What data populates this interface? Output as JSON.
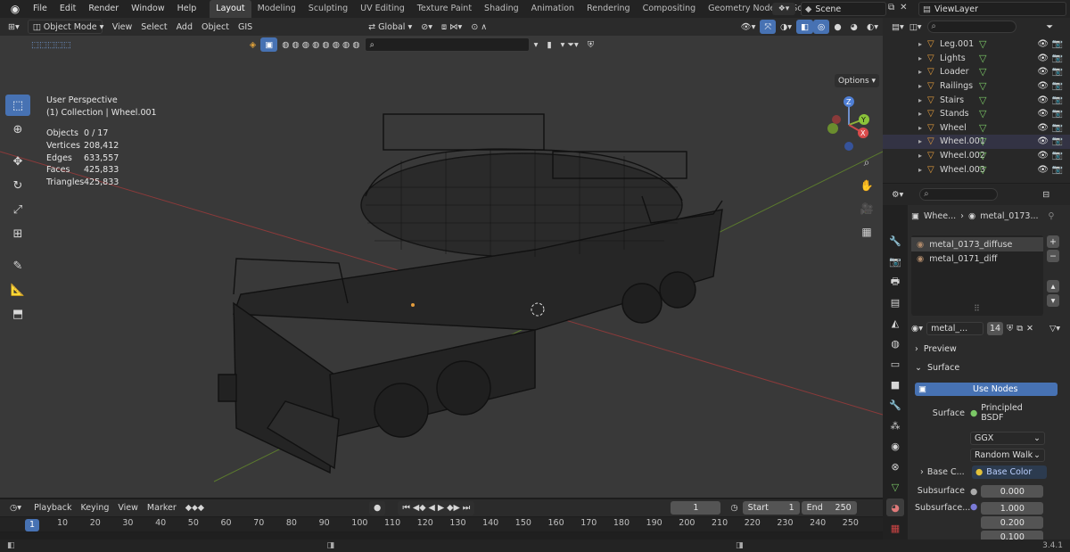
{
  "topbar": {
    "menus": [
      "File",
      "Edit",
      "Render",
      "Window",
      "Help"
    ],
    "workspaces": [
      "Layout",
      "Modeling",
      "Sculpting",
      "UV Editing",
      "Texture Paint",
      "Shading",
      "Animation",
      "Rendering",
      "Compositing",
      "Geometry Nodes",
      "Scripting"
    ],
    "active_workspace": "Layout",
    "scene": "Scene",
    "view_layer": "ViewLayer"
  },
  "viewport_header": {
    "mode": "Object Mode",
    "menus": [
      "View",
      "Select",
      "Add",
      "Object",
      "GIS"
    ],
    "transform_orientation": "Global",
    "options_label": "Options"
  },
  "viewport": {
    "perspective": "User Perspective",
    "collection": "(1) Collection | Wheel.001",
    "stats": [
      {
        "label": "Objects",
        "value": "0 / 17"
      },
      {
        "label": "Vertices",
        "value": "208,412"
      },
      {
        "label": "Edges",
        "value": "633,557"
      },
      {
        "label": "Faces",
        "value": "425,833"
      },
      {
        "label": "Triangles",
        "value": "425,833"
      }
    ],
    "gizmo": {
      "z": "Z",
      "y": "Y",
      "x": "X"
    }
  },
  "timeline": {
    "menus": [
      "Playback",
      "Keying",
      "View",
      "Marker"
    ],
    "current_frame": "1",
    "start_label": "Start",
    "start": "1",
    "end_label": "End",
    "end": "250",
    "ticks": [
      "1",
      "10",
      "20",
      "30",
      "40",
      "50",
      "60",
      "70",
      "80",
      "90",
      "100",
      "110",
      "120",
      "130",
      "140",
      "150",
      "160",
      "170",
      "180",
      "190",
      "200",
      "210",
      "220",
      "230",
      "240",
      "250"
    ]
  },
  "outliner": {
    "items": [
      {
        "name": "Leg.001",
        "selected": false
      },
      {
        "name": "Lights",
        "selected": false
      },
      {
        "name": "Loader",
        "selected": false
      },
      {
        "name": "Railings",
        "selected": false
      },
      {
        "name": "Stairs",
        "selected": false
      },
      {
        "name": "Stands",
        "selected": false
      },
      {
        "name": "Wheel",
        "selected": false
      },
      {
        "name": "Wheel.001",
        "selected": true
      },
      {
        "name": "Wheel.002",
        "selected": false
      },
      {
        "name": "Wheel.003",
        "selected": false
      }
    ]
  },
  "properties": {
    "breadcrumb_object": "Whee...",
    "breadcrumb_material": "metal_0173...",
    "materials": [
      "metal_0173_diffuse",
      "metal_0171_diff"
    ],
    "material_name": "metal_...",
    "users": "14",
    "preview_label": "Preview",
    "surface_label": "Surface",
    "use_nodes": "Use Nodes",
    "surface_field_label": "Surface",
    "surface_shader": "Principled BSDF",
    "distribution": "GGX",
    "subsurface_method": "Random Walk",
    "base_color_label": "Base C...",
    "base_color_value": "Base Color",
    "subsurface_label": "Subsurface",
    "subsurface_value": "0.000",
    "subsurface_radius_label": "Subsurface...",
    "radius_values": [
      "1.000",
      "0.200",
      "0.100"
    ]
  },
  "statusbar": {
    "version": "3.4.1"
  },
  "colors": {
    "accent": "#4772b3",
    "object_orange": "#e59d3d",
    "filter_green": "#7bc866"
  }
}
